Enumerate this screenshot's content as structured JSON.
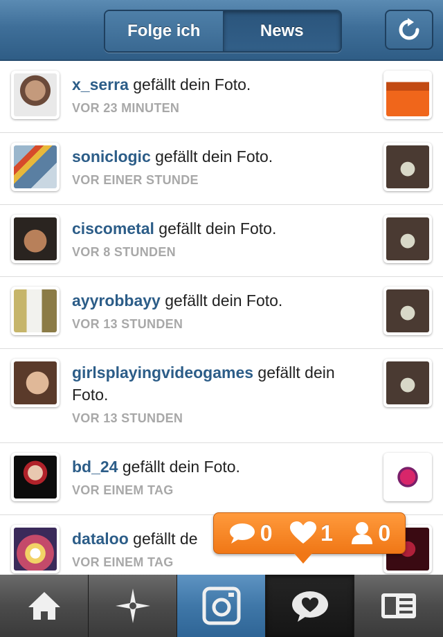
{
  "header": {
    "tabs": [
      {
        "label": "Folge ich",
        "active": false
      },
      {
        "label": "News",
        "active": true
      }
    ],
    "refresh_icon": "refresh-icon"
  },
  "feed": [
    {
      "user": "x_serra",
      "action": "gefällt dein Foto.",
      "time": "VOR 23 MINUTEN"
    },
    {
      "user": "soniclogic",
      "action": "gefällt dein Foto.",
      "time": "VOR EINER STUNDE"
    },
    {
      "user": "ciscometal",
      "action": "gefällt dein Foto.",
      "time": "VOR 8 STUNDEN"
    },
    {
      "user": "ayyrobbayy",
      "action": "gefällt dein Foto.",
      "time": "VOR 13 STUNDEN"
    },
    {
      "user": "girlsplayingvideogames",
      "action": "gefällt dein Foto.",
      "time": "VOR 13 STUNDEN"
    },
    {
      "user": "bd_24",
      "action": "gefällt dein Foto.",
      "time": "VOR EINEM TAG"
    },
    {
      "user": "dataloo",
      "action": "gefällt de",
      "time": "VOR EINEM TAG"
    }
  ],
  "notifications": {
    "comments": "0",
    "likes": "1",
    "followers": "0"
  },
  "tabbar": [
    "home-icon",
    "explore-icon",
    "camera-icon",
    "news-icon",
    "profile-icon"
  ],
  "colors": {
    "header": "#3f6f99",
    "username": "#2c5d88",
    "timestamp": "#a8a8a8",
    "bubble": "#f07716"
  }
}
